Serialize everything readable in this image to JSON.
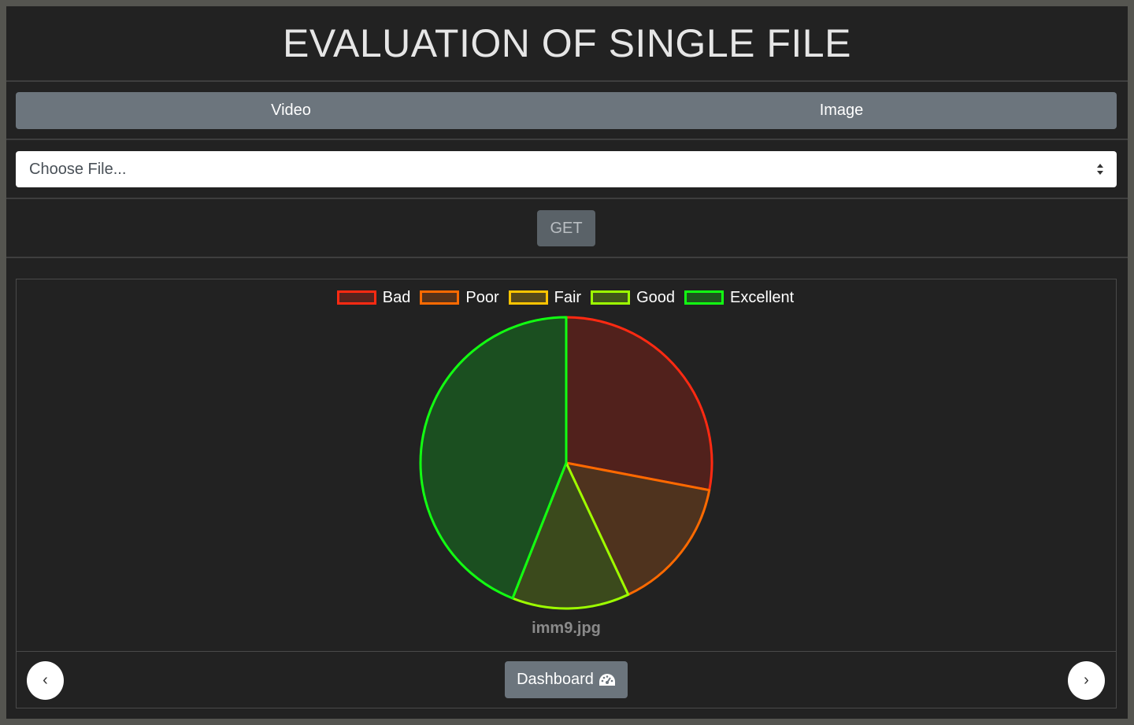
{
  "header": {
    "title": "EVALUATION OF SINGLE FILE"
  },
  "tabs": [
    {
      "label": "Video"
    },
    {
      "label": "Image"
    }
  ],
  "file_select": {
    "value": "Choose File..."
  },
  "get_button": {
    "label": "GET"
  },
  "chart_data": {
    "type": "pie",
    "labels": [
      "Bad",
      "Poor",
      "Fair",
      "Good",
      "Excellent"
    ],
    "values": [
      28,
      15,
      0,
      13,
      44
    ],
    "colors": [
      "#ff2a12",
      "#ff6a00",
      "#ffc400",
      "#9dff00",
      "#12ff12"
    ],
    "legend_position": "top",
    "caption": "imm9.jpg"
  },
  "footer": {
    "prev_label": "‹",
    "next_label": "›",
    "dashboard_label": "Dashboard",
    "dashboard_icon": "tachometer-icon"
  }
}
